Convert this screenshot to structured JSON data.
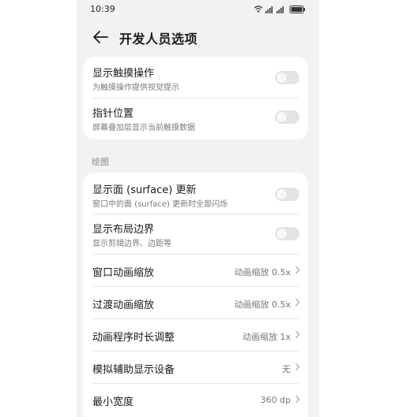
{
  "status_bar": {
    "time": "10:39",
    "signal1": "4G",
    "signal2": "4G",
    "battery": "99"
  },
  "header": {
    "title": "开发人员选项"
  },
  "card_top": [
    {
      "title": "显示触摸操作",
      "subtitle": "为触摸操作提供视觉提示",
      "enabled": false
    },
    {
      "title": "指针位置",
      "subtitle": "屏幕叠加层显示当前触摸数据",
      "enabled": false
    }
  ],
  "section_drawing": {
    "label": "绘图",
    "toggles": [
      {
        "title": "显示面 (surface) 更新",
        "subtitle": "窗口中的面 (surface) 更新时全部闪烁",
        "enabled": false
      },
      {
        "title": "显示布局边界",
        "subtitle": "显示剪辑边界、边距等",
        "enabled": false
      }
    ],
    "options": [
      {
        "title": "窗口动画缩放",
        "value": "动画缩放 0.5x"
      },
      {
        "title": "过渡动画缩放",
        "value": "动画缩放 0.5x"
      },
      {
        "title": "动画程序时长调整",
        "value": "动画缩放 1x"
      },
      {
        "title": "模拟辅助显示设备",
        "value": "无"
      },
      {
        "title": "最小宽度",
        "value": "360 dp"
      }
    ]
  },
  "colors": {
    "background": "#f1f2f4",
    "card": "#ffffff",
    "toggle_off": "#e3e4e6"
  }
}
